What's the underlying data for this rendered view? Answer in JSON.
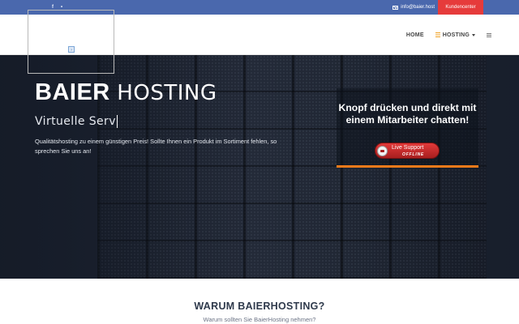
{
  "topbar": {
    "social": [
      {
        "name": "facebook-icon",
        "glyph": "f"
      },
      {
        "name": "twitter-icon",
        "glyph": "•"
      }
    ],
    "email": "info@baier.host",
    "kundencenter_label": "Kundencenter",
    "bg_color": "#4a68ad",
    "accent_color": "#e63b3b"
  },
  "nav": {
    "home_label": "HOME",
    "hosting_label": "HOSTING",
    "hosting_icon": "server-icon",
    "menu_icon": "hamburger-icon"
  },
  "hero": {
    "title_bold": "BAIER",
    "title_light": "HOSTING",
    "subtitle": "Virtuelle Serv",
    "description": "Qualitätshosting zu einem günstigen Preis! Sollte Ihnen ein Produkt im Sortiment fehlen, so sprechen Sie uns an!"
  },
  "support": {
    "message": "Knopf drücken und direkt mit einem Mitarbeiter chatten!",
    "button_label": "Live Support",
    "status": "OFFLINE",
    "accent_color": "#f07a1a"
  },
  "section": {
    "heading": "WARUM BAIERHOSTING?",
    "subheading": "Warum sollten Sie BaierHosting nehmen?"
  }
}
